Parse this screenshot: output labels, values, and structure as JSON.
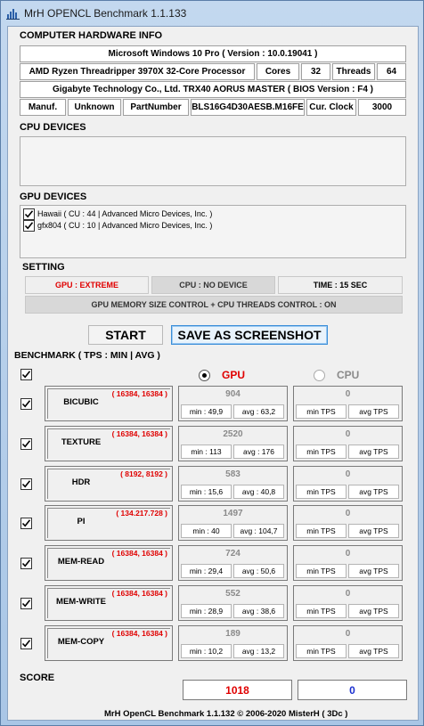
{
  "window": {
    "title": "MrH OPENCL Benchmark 1.1.133"
  },
  "hardware": {
    "header": "COMPUTER HARDWARE INFO",
    "os": "Microsoft Windows 10 Pro ( Version : 10.0.19041 )",
    "cpu": "AMD Ryzen Threadripper 3970X 32-Core Processor",
    "cores_label": "Cores",
    "cores_value": "32",
    "threads_label": "Threads",
    "threads_value": "64",
    "board": "Gigabyte Technology Co., Ltd. TRX40 AORUS MASTER ( BIOS Version : F4 )",
    "manuf_label": "Manuf.",
    "manuf_value": "Unknown",
    "part_label": "PartNumber",
    "part_value": "BLS16G4D30AESB.M16FE",
    "clock_label": "Cur. Clock",
    "clock_value": "3000"
  },
  "cpu_devices": {
    "header": "CPU DEVICES"
  },
  "gpu_devices": {
    "header": "GPU DEVICES",
    "items": [
      {
        "label": "Hawaii ( CU : 44 | Advanced Micro Devices, Inc. )",
        "checked": true
      },
      {
        "label": "gfx804 ( CU : 10 | Advanced Micro Devices, Inc. )",
        "checked": true
      }
    ]
  },
  "setting": {
    "header": "SETTING",
    "gpu_mode": "GPU : EXTREME",
    "cpu_mode": "CPU : NO DEVICE",
    "time": "TIME : 15 SEC",
    "memory_control": "GPU MEMORY SIZE CONTROL + CPU THREADS CONTROL : ON"
  },
  "buttons": {
    "start": "START",
    "save": "SAVE AS SCREENSHOT"
  },
  "benchmark": {
    "header": "BENCHMARK ( TPS : MIN | AVG )",
    "gpu_label": "GPU",
    "cpu_label": "CPU",
    "selected": "GPU",
    "colors": {
      "resolution": "#e00000",
      "gpu_label": "#e00000",
      "cpu_score": "#1a2fd0"
    },
    "rows": [
      {
        "name": "BICUBIC",
        "res": "( 16384, 16384 )",
        "gpu_val": "904",
        "gpu_min": "min : 49,9",
        "gpu_avg": "avg : 63,2",
        "cpu_val": "0",
        "cpu_min": "min TPS",
        "cpu_avg": "avg TPS"
      },
      {
        "name": "TEXTURE",
        "res": "( 16384, 16384 )",
        "gpu_val": "2520",
        "gpu_min": "min : 113",
        "gpu_avg": "avg : 176",
        "cpu_val": "0",
        "cpu_min": "min TPS",
        "cpu_avg": "avg TPS"
      },
      {
        "name": "HDR",
        "res": "( 8192, 8192 )",
        "gpu_val": "583",
        "gpu_min": "min : 15,6",
        "gpu_avg": "avg : 40,8",
        "cpu_val": "0",
        "cpu_min": "min TPS",
        "cpu_avg": "avg TPS"
      },
      {
        "name": "PI",
        "res": "( 134.217.728 )",
        "gpu_val": "1497",
        "gpu_min": "min : 40",
        "gpu_avg": "avg : 104,7",
        "cpu_val": "0",
        "cpu_min": "min TPS",
        "cpu_avg": "avg TPS"
      },
      {
        "name": "MEM-READ",
        "res": "( 16384, 16384 )",
        "gpu_val": "724",
        "gpu_min": "min : 29,4",
        "gpu_avg": "avg : 50,6",
        "cpu_val": "0",
        "cpu_min": "min TPS",
        "cpu_avg": "avg TPS"
      },
      {
        "name": "MEM-WRITE",
        "res": "( 16384, 16384 )",
        "gpu_val": "552",
        "gpu_min": "min : 28,9",
        "gpu_avg": "avg : 38,6",
        "cpu_val": "0",
        "cpu_min": "min TPS",
        "cpu_avg": "avg TPS"
      },
      {
        "name": "MEM-COPY",
        "res": "( 16384, 16384 )",
        "gpu_val": "189",
        "gpu_min": "min : 10,2",
        "gpu_avg": "avg : 13,2",
        "cpu_val": "0",
        "cpu_min": "min TPS",
        "cpu_avg": "avg TPS"
      }
    ]
  },
  "score": {
    "header": "SCORE",
    "gpu": "1018",
    "cpu": "0"
  },
  "footer": "MrH OpenCL Benchmark 1.1.132  ©  2006-2020 MisterH ( 3Dc )"
}
